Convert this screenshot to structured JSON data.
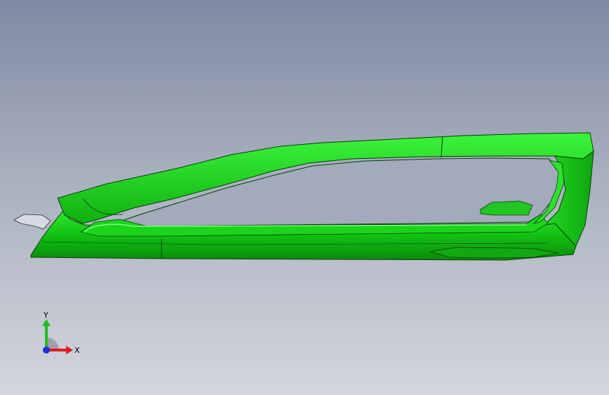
{
  "viewport": {
    "background_top": "#7f8aa3",
    "background_bottom": "#d3d6df",
    "part_color": "#18d018",
    "part_dark": "#0a8c0a",
    "part_edge": "#063f06"
  },
  "triad": {
    "x_label": "X",
    "y_label": "Y",
    "x_color": "#e21b1b",
    "y_color": "#1fbf1f",
    "z_color": "#1a2cdc"
  }
}
